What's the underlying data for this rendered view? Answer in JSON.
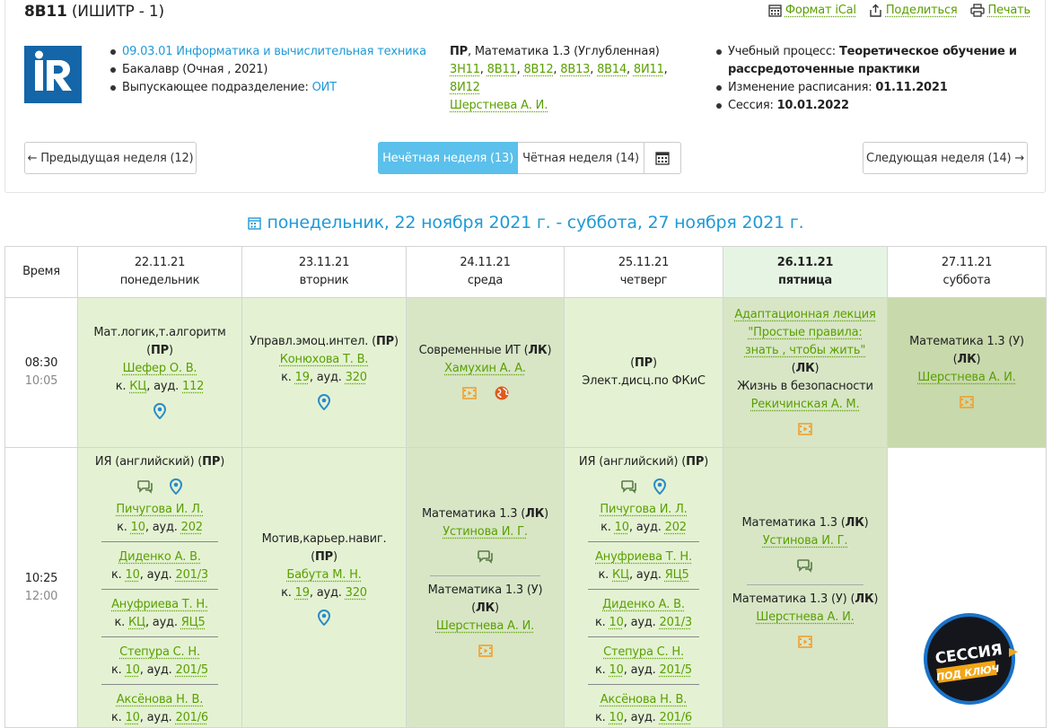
{
  "header": {
    "group": "8В11",
    "group_sub": "(ИШИТР - 1)",
    "links": {
      "ical": "Формат iCal",
      "share": "Поделиться",
      "print": "Печать"
    }
  },
  "info": {
    "program_code": "09.03.01 Информатика и вычислительная техника",
    "degree": "Бакалавр (Очная , 2021)",
    "dept_label": "Выпускающее подразделение:",
    "dept_value": "ОИТ",
    "selected_kind": "ПР",
    "selected_subject": ", Математика 1.3 (Углубленная)",
    "groups": [
      "3Н11",
      "8В11",
      "8В12",
      "8В13",
      "8В14",
      "8И11",
      "8И12"
    ],
    "teacher": "Шерстнева А. И.",
    "process_label": "Учебный процесс:",
    "process_value": "Теоретическое обучение и рассредоточенные практики",
    "change_label": "Изменение расписания:",
    "change_value": "01.11.2021",
    "session_label": "Сессия:",
    "session_value": "10.01.2022"
  },
  "nav": {
    "prev": "← Предыдущая неделя (12)",
    "odd": "Нечётная неделя (13)",
    "even": "Чётная неделя (14)",
    "next": "Следующая неделя (14) →"
  },
  "week_range": "понедельник, 22 ноября 2021 г. - суббота, 27 ноября 2021 г.",
  "table": {
    "time_header": "Время",
    "days": [
      {
        "date": "22.11.21",
        "name": "понедельник"
      },
      {
        "date": "23.11.21",
        "name": "вторник"
      },
      {
        "date": "24.11.21",
        "name": "среда"
      },
      {
        "date": "25.11.21",
        "name": "четверг"
      },
      {
        "date": "26.11.21",
        "name": "пятница"
      },
      {
        "date": "27.11.21",
        "name": "суббота"
      }
    ],
    "slot1": {
      "start": "08:30",
      "end": "10:05"
    },
    "slot2": {
      "start": "10:25",
      "end": "12:00"
    }
  },
  "lessons": {
    "r1": {
      "mon": {
        "subj": "Мат.логик,т.алгоритм",
        "kind": "ПР",
        "teacher": "Шефер О. В.",
        "room_pre": "к.",
        "bld": "КЦ",
        "aud_pre": ", ауд.",
        "aud": "112"
      },
      "tue": {
        "subj": "Управл.эмоц.интел.",
        "kind": "ПР",
        "teacher": "Конюхова Т. В.",
        "room_pre": "к.",
        "bld": "19",
        "aud_pre": ", ауд.",
        "aud": "320"
      },
      "wed": {
        "subj": "Современные ИТ",
        "kind": "ЛК",
        "teacher": "Хамухин А. А."
      },
      "thu": {
        "kind": "ПР",
        "subj": "Элект.дисц.по ФКиС"
      },
      "fri": {
        "link1": "Адаптационная лекция",
        "link2": "\"Простые правила:",
        "link3": "знать , чтобы жить\"",
        "kind": "ЛК",
        "subj": "Жизнь в безопасности",
        "teacher": "Рекичинская А. М."
      },
      "sat": {
        "subj": "Математика 1.3 (У)",
        "kind": "ЛК",
        "teacher": "Шерстнева А. И."
      }
    },
    "r2": {
      "mon": {
        "subj": "ИЯ (английский)",
        "kind": "ПР",
        "teachers": [
          {
            "name": "Пичугова И. Л.",
            "bld": "10",
            "aud": "202"
          },
          {
            "name": "Диденко А. В.",
            "bld": "10",
            "aud": "201/3"
          },
          {
            "name": "Ануфриева Т. Н.",
            "bld": "КЦ",
            "aud": "ЯЦ5"
          },
          {
            "name": "Степура С. Н.",
            "bld": "10",
            "aud": "201/5"
          },
          {
            "name": "Аксёнова Н. В.",
            "bld": "10",
            "aud": "201/6"
          }
        ]
      },
      "tue": {
        "subj": "Мотив,карьер.навиг.",
        "kind": "ПР",
        "teacher": "Бабута М. Н.",
        "bld": "19",
        "aud": "320"
      },
      "wed": {
        "a_subj": "Математика 1.3",
        "a_kind": "ЛК",
        "a_teacher": "Устинова И. Г.",
        "b_subj": "Математика 1.3 (У)",
        "b_kind": "ЛК",
        "b_teacher": "Шерстнева А. И."
      },
      "thu": {
        "subj": "ИЯ (английский)",
        "kind": "ПР",
        "teachers": [
          {
            "name": "Пичугова И. Л.",
            "bld": "10",
            "aud": "202"
          },
          {
            "name": "Ануфриева Т. Н.",
            "bld": "КЦ",
            "aud": "ЯЦ5"
          },
          {
            "name": "Диденко А. В.",
            "bld": "10",
            "aud": "201/3"
          },
          {
            "name": "Степура С. Н.",
            "bld": "10",
            "aud": "201/5"
          },
          {
            "name": "Аксёнова Н. В.",
            "bld": "10",
            "aud": "201/6"
          }
        ]
      },
      "fri": {
        "a_subj": "Математика 1.3",
        "a_kind": "ЛК",
        "a_teacher": "Устинова И. Г.",
        "b_subj": "Математика 1.3 (У)",
        "b_kind": "ЛК",
        "b_teacher": "Шерстнева А. И."
      }
    }
  },
  "common": {
    "k": "к.",
    "aud": ", ауд."
  },
  "promo": {
    "line1": "СЕССИЯ",
    "line2": "ПОД КЛЮЧ"
  }
}
